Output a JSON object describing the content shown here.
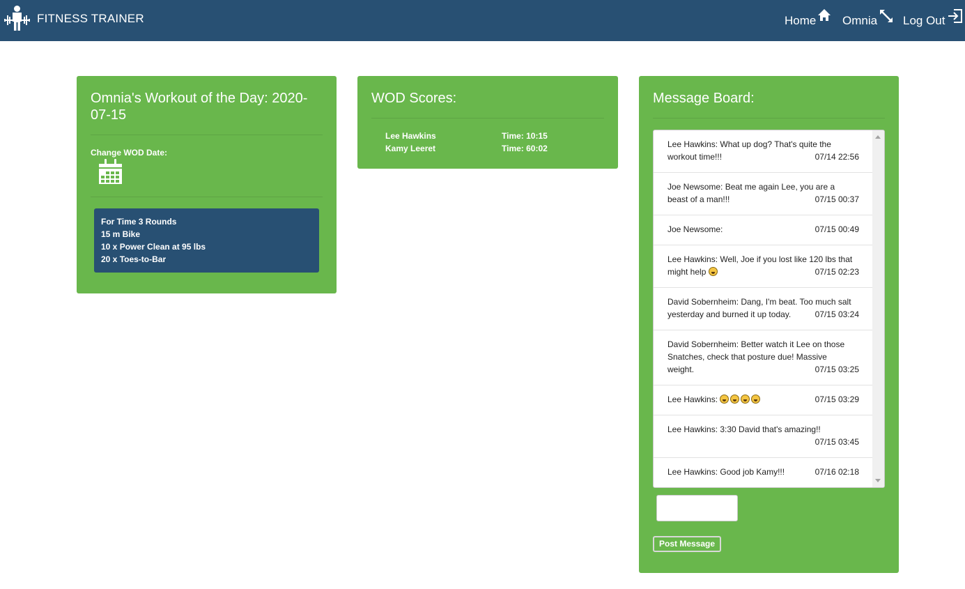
{
  "nav": {
    "brand": "FITNESS TRAINER",
    "links": [
      {
        "label": "Home",
        "icon": "home-icon"
      },
      {
        "label": "Omnia",
        "icon": "expand-arrows-icon"
      },
      {
        "label": "Log Out",
        "icon": "logout-icon"
      }
    ]
  },
  "wod": {
    "title": "Omnia's Workout of the Day: 2020-07-15",
    "change_label": "Change WOD Date:",
    "lines": [
      "For Time 3 Rounds",
      "15 m Bike",
      "10 x Power Clean at 95 lbs",
      "20 x Toes-to-Bar"
    ]
  },
  "scores": {
    "title": "WOD Scores:",
    "rows": [
      {
        "name": "Lee Hawkins",
        "time": "Time: 10:15"
      },
      {
        "name": "Kamy Leeret",
        "time": "Time: 60:02"
      }
    ]
  },
  "board": {
    "title": "Message Board:",
    "messages": [
      {
        "text": "Lee Hawkins: What up dog? That's quite the workout time!!!",
        "time": "07/14 22:56"
      },
      {
        "text": "Joe Newsome: Beat me again Lee, you are a beast of a man!!!",
        "time": "07/15 00:37"
      },
      {
        "text": "Joe Newsome:",
        "time": "07/15 00:49"
      },
      {
        "text": "Lee Hawkins: Well, Joe if you lost like 120 lbs that might help",
        "time": "07/15 02:23",
        "emoji_count": 1
      },
      {
        "text": "David Sobernheim: Dang, I'm beat. Too much salt yesterday and burned it up today.",
        "time": "07/15 03:24"
      },
      {
        "text": "David Sobernheim: Better watch it Lee on those Snatches, check that posture due! Massive weight.",
        "time": "07/15 03:25"
      },
      {
        "text": "Lee Hawkins:",
        "time": "07/15 03:29",
        "emoji_count": 4
      },
      {
        "text": "Lee Hawkins: 3:30 David that's amazing!!",
        "time": "07/15 03:45"
      },
      {
        "text": "Lee Hawkins: Good job Kamy!!!",
        "time": "07/16 02:18"
      }
    ],
    "input_value": "",
    "post_label": "Post Message"
  },
  "colors": {
    "navbar": "#285073",
    "card": "#69b74c",
    "wod_box": "#285073"
  }
}
